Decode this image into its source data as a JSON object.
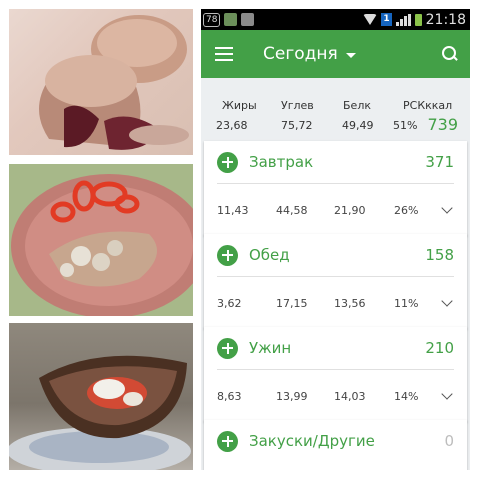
{
  "status_bar": {
    "badge": "78",
    "signal_number": "1",
    "time": "21:18"
  },
  "app_bar": {
    "title": "Сегодня",
    "menu_icon": "menu-icon",
    "search_icon": "search-icon"
  },
  "summary": {
    "labels": [
      "Жиры",
      "Углев",
      "Белк",
      "РСКккал"
    ],
    "values": [
      "23,68",
      "75,72",
      "49,49",
      "51%"
    ],
    "kcal": "739"
  },
  "meals": [
    {
      "title": "Завтрак",
      "kcal": "371",
      "fat": "11,43",
      "carbs": "44,58",
      "protein": "21,90",
      "pct": "26%"
    },
    {
      "title": "Обед",
      "kcal": "158",
      "fat": "3,62",
      "carbs": "17,15",
      "protein": "13,56",
      "pct": "11%"
    },
    {
      "title": "Ужин",
      "kcal": "210",
      "fat": "8,63",
      "carbs": "13,99",
      "protein": "14,03",
      "pct": "14%"
    },
    {
      "title": "Закуски/Другие",
      "kcal": "0"
    }
  ],
  "colors": {
    "accent": "#43a047",
    "background": "#eceff1"
  }
}
